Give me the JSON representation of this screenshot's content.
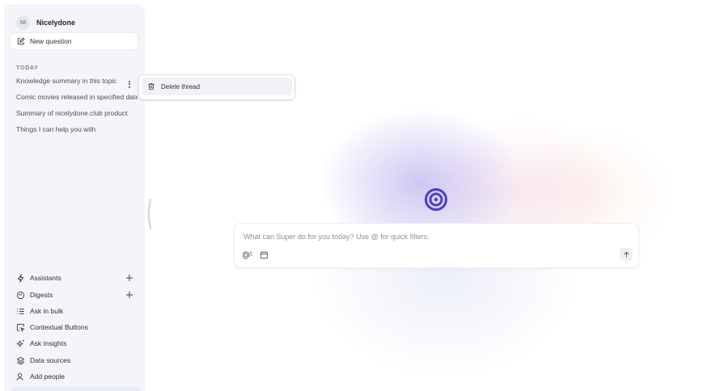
{
  "workspace": {
    "initials": "NI",
    "name": "Nicelydone"
  },
  "new_question": {
    "label": "New question"
  },
  "threads": {
    "section_label": "TODAY",
    "items": [
      {
        "label": "Knowledge summary in this topic"
      },
      {
        "label": "Comic movies released in specified dates"
      },
      {
        "label": "Summary of nicelydone.club product"
      },
      {
        "label": "Things I can help you with"
      }
    ]
  },
  "thread_menu": {
    "delete_label": "Delete thread"
  },
  "nav": {
    "items": [
      {
        "label": "Assistants",
        "icon": "lightning-icon"
      },
      {
        "label": "Digests",
        "icon": "digest-icon"
      },
      {
        "label": "Ask in bulk",
        "icon": "list-icon"
      },
      {
        "label": "Contextual Buttons",
        "icon": "cursor-box-icon"
      },
      {
        "label": "Ask insights",
        "icon": "sparkle-icon"
      },
      {
        "label": "Data sources",
        "icon": "layers-icon"
      },
      {
        "label": "Add people",
        "icon": "user-add-icon"
      }
    ]
  },
  "composer": {
    "placeholder": "What can Super do for you today? Use @ for quick filters."
  },
  "colors": {
    "accent": "#4b3fc7",
    "sidebar_bg": "#f4f5f8"
  }
}
